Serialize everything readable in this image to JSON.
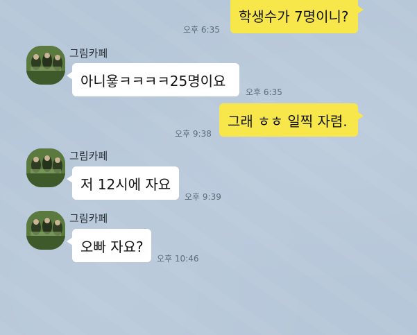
{
  "chat": {
    "sender_name": "그림카페",
    "messages": [
      {
        "direction": "out",
        "text": "학생수가 7명이니?",
        "time": "오후 6:35"
      },
      {
        "direction": "in",
        "text": "아니욯ㅋㅋㅋㅋ25명이요",
        "time": "오후 6:35"
      },
      {
        "direction": "out",
        "text": "그래 ㅎㅎ 일찍 자렴.",
        "time": "오후 9:38"
      },
      {
        "direction": "in",
        "text": "저 12시에 자요",
        "time": "오후 9:39"
      },
      {
        "direction": "in",
        "text": "오빠 자요?",
        "time": "오후 10:46"
      }
    ]
  },
  "colors": {
    "background": "#b6c7d9",
    "outgoing_bubble": "#f8e74a",
    "incoming_bubble": "#ffffff",
    "timestamp": "#5e6c7a"
  },
  "icons": {
    "avatar": "group-photo-avatar"
  }
}
